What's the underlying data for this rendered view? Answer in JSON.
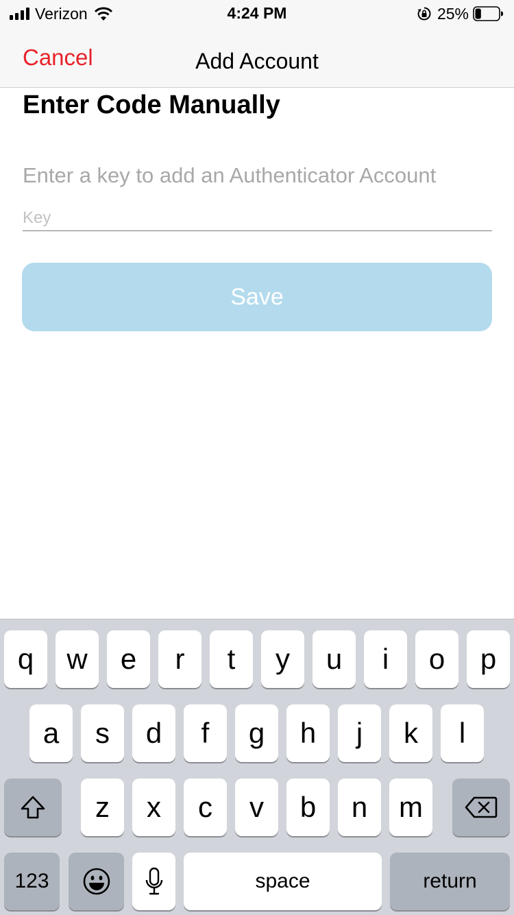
{
  "status_bar": {
    "carrier": "Verizon",
    "time": "4:24 PM",
    "battery_percent": "25%",
    "battery_level": 0.25,
    "icons": [
      "signal-icon",
      "wifi-icon",
      "rotation-lock-icon",
      "battery-icon"
    ]
  },
  "nav": {
    "cancel_label": "Cancel",
    "title": "Add Account",
    "cancel_color": "#e8232b"
  },
  "content": {
    "heading": "Enter Code Manually",
    "instruction": "Enter a key to add an Authenticator Account",
    "key_placeholder": "Key",
    "key_value": "",
    "save_label": "Save",
    "save_color": "#b3dbed"
  },
  "keyboard": {
    "row1": [
      "q",
      "w",
      "e",
      "r",
      "t",
      "y",
      "u",
      "i",
      "o",
      "p"
    ],
    "row2": [
      "a",
      "s",
      "d",
      "f",
      "g",
      "h",
      "j",
      "k",
      "l"
    ],
    "row3": [
      "z",
      "x",
      "c",
      "v",
      "b",
      "n",
      "m"
    ],
    "numbers_label": "123",
    "space_label": "space",
    "return_label": "return",
    "icons": [
      "shift-icon",
      "delete-icon",
      "emoji-icon",
      "microphone-icon"
    ]
  }
}
